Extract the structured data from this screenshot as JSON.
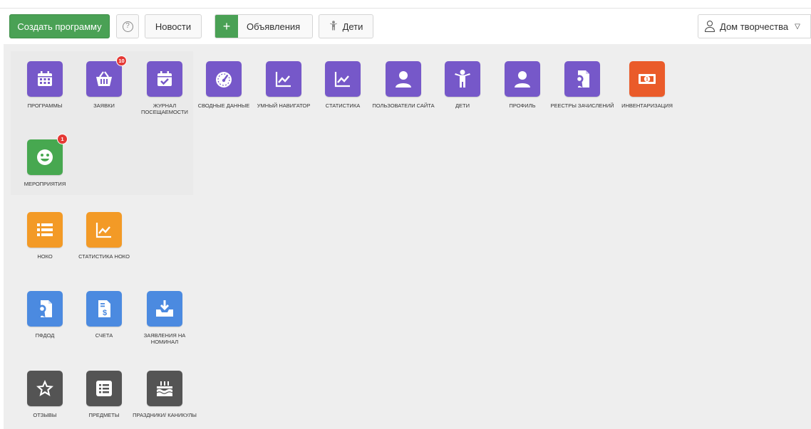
{
  "toolbar": {
    "create_program": "Создать программу",
    "news": "Новости",
    "announcements": "Объявления",
    "kids": "Дети",
    "user": "Дом творчества"
  },
  "colors": {
    "primary_green": "#4aa155",
    "tile_purple": "#7658c9",
    "tile_green": "#47a850",
    "tile_orange": "#f39a26",
    "tile_red": "#ea5b2a",
    "tile_blue": "#4b8ae0",
    "tile_gray": "#545454",
    "badge_red": "#e53935"
  },
  "tiles": {
    "programs": {
      "label": "ПРОГРАММЫ",
      "icon": "calendar-icon"
    },
    "applications": {
      "label": "ЗАЯВКИ",
      "icon": "basket-icon",
      "badge": "10"
    },
    "attendance": {
      "label": "ЖУРНАЛ ПОСЕЩАЕМОСТИ",
      "icon": "calendar-check-icon"
    },
    "summary": {
      "label": "СВОДНЫЕ ДАННЫЕ",
      "icon": "gauge-icon"
    },
    "navigator": {
      "label": "УМНЫЙ НАВИГАТОР",
      "icon": "trend-chart-icon"
    },
    "statistics": {
      "label": "СТАТИСТИКА",
      "icon": "trend-chart-icon"
    },
    "site_users": {
      "label": "ПОЛЬЗОВАТЕЛИ САЙТА",
      "icon": "user-icon"
    },
    "children": {
      "label": "ДЕТИ",
      "icon": "child-icon"
    },
    "profile": {
      "label": "ПРОФИЛЬ",
      "icon": "user-icon"
    },
    "registries": {
      "label": "РЕЕСТРЫ ЗАЧИСЛЕНИЙ",
      "icon": "certificate-doc-icon"
    },
    "inventory": {
      "label": "ИНВЕНТАРИЗАЦИЯ",
      "icon": "banknote-icon",
      "symbol": "1"
    },
    "events": {
      "label": "МЕРОПРИЯТИЯ",
      "icon": "smiley-icon",
      "badge": "1"
    },
    "noko": {
      "label": "НОКО",
      "icon": "list-icon"
    },
    "noko_stats": {
      "label": "СТАТИСТИКА НОКО",
      "icon": "trend-chart-icon"
    },
    "pfdod": {
      "label": "ПФДОД",
      "icon": "certificate-doc-icon"
    },
    "invoices": {
      "label": "СЧЕТА",
      "icon": "invoice-icon",
      "symbol": "$"
    },
    "nominal_requests": {
      "label": "ЗАЯВЛЕНИЯ НА НОМИНАЛ",
      "icon": "inbox-download-icon"
    },
    "reviews": {
      "label": "ОТЗЫВЫ",
      "icon": "star-icon"
    },
    "subjects": {
      "label": "ПРЕДМЕТЫ",
      "icon": "list-box-icon"
    },
    "holidays": {
      "label": "ПРАЗДНИКИ/ КАНИКУЛЫ",
      "icon": "cake-icon"
    }
  }
}
